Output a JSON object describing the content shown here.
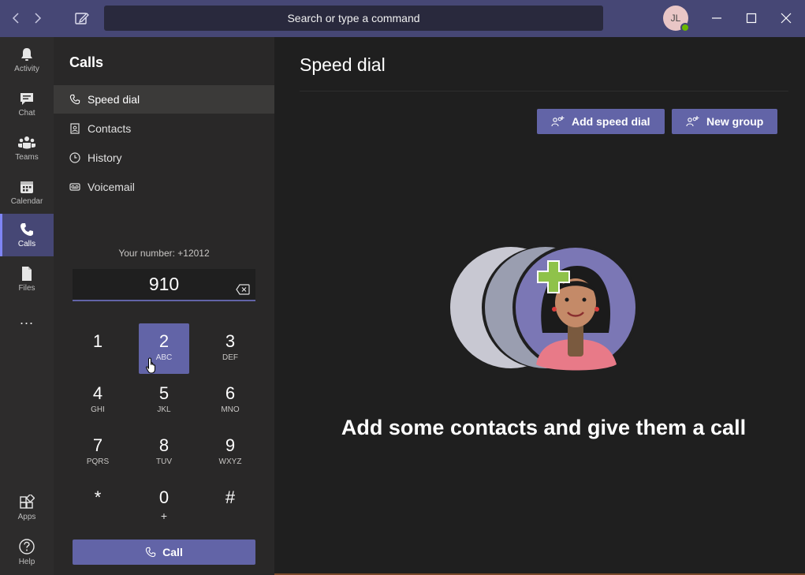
{
  "titlebar": {
    "search_placeholder": "Search or type a command",
    "avatar_initials": "JL"
  },
  "rail": {
    "items": [
      {
        "label": "Activity",
        "icon": "bell-icon"
      },
      {
        "label": "Chat",
        "icon": "chat-icon"
      },
      {
        "label": "Teams",
        "icon": "teams-icon"
      },
      {
        "label": "Calendar",
        "icon": "calendar-icon"
      },
      {
        "label": "Calls",
        "icon": "phone-icon",
        "active": true
      },
      {
        "label": "Files",
        "icon": "file-icon"
      },
      {
        "label": "...",
        "icon": "more-icon"
      },
      {
        "label": "Apps",
        "icon": "apps-icon"
      },
      {
        "label": "Help",
        "icon": "help-icon"
      }
    ]
  },
  "panel": {
    "title": "Calls",
    "nav": [
      {
        "label": "Speed dial",
        "icon": "phone-icon",
        "active": true
      },
      {
        "label": "Contacts",
        "icon": "contacts-icon"
      },
      {
        "label": "History",
        "icon": "clock-icon"
      },
      {
        "label": "Voicemail",
        "icon": "voicemail-icon"
      }
    ],
    "your_number": "Your number: +12012",
    "dial_value": "910",
    "keys": [
      {
        "digit": "1",
        "letters": ""
      },
      {
        "digit": "2",
        "letters": "ABC",
        "pressed": true
      },
      {
        "digit": "3",
        "letters": "DEF"
      },
      {
        "digit": "4",
        "letters": "GHI"
      },
      {
        "digit": "5",
        "letters": "JKL"
      },
      {
        "digit": "6",
        "letters": "MNO"
      },
      {
        "digit": "7",
        "letters": "PQRS"
      },
      {
        "digit": "8",
        "letters": "TUV"
      },
      {
        "digit": "9",
        "letters": "WXYZ"
      },
      {
        "digit": "*",
        "letters": ""
      },
      {
        "digit": "0",
        "letters": "+"
      },
      {
        "digit": "#",
        "letters": ""
      }
    ],
    "call_label": "Call"
  },
  "main": {
    "title": "Speed dial",
    "add_speed_dial_label": "Add speed dial",
    "new_group_label": "New group",
    "empty_message": "Add some contacts and give them a call"
  },
  "colors": {
    "accent": "#6264a7",
    "titlebar": "#464775",
    "presence": "#6bb700"
  }
}
